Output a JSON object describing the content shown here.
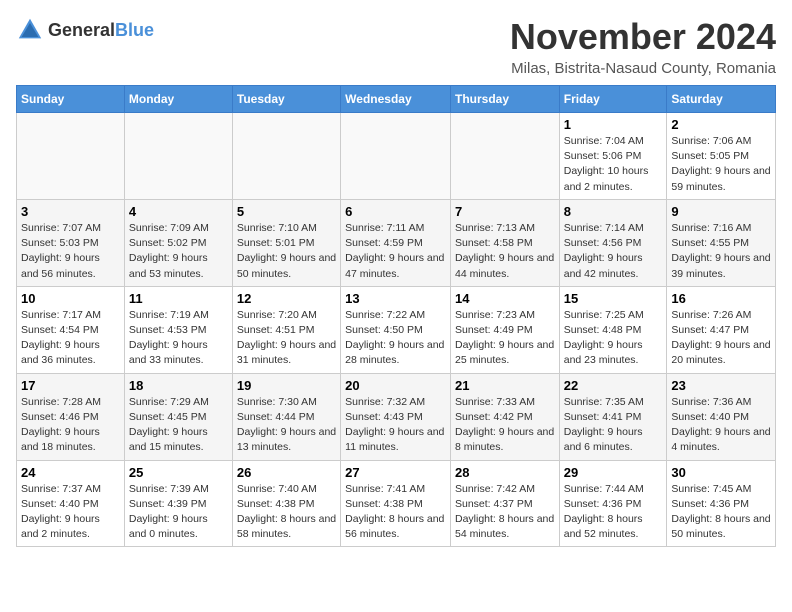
{
  "logo": {
    "general": "General",
    "blue": "Blue"
  },
  "header": {
    "month": "November 2024",
    "location": "Milas, Bistrita-Nasaud County, Romania"
  },
  "days_of_week": [
    "Sunday",
    "Monday",
    "Tuesday",
    "Wednesday",
    "Thursday",
    "Friday",
    "Saturday"
  ],
  "weeks": [
    [
      {
        "day": "",
        "info": ""
      },
      {
        "day": "",
        "info": ""
      },
      {
        "day": "",
        "info": ""
      },
      {
        "day": "",
        "info": ""
      },
      {
        "day": "",
        "info": ""
      },
      {
        "day": "1",
        "info": "Sunrise: 7:04 AM\nSunset: 5:06 PM\nDaylight: 10 hours and 2 minutes."
      },
      {
        "day": "2",
        "info": "Sunrise: 7:06 AM\nSunset: 5:05 PM\nDaylight: 9 hours and 59 minutes."
      }
    ],
    [
      {
        "day": "3",
        "info": "Sunrise: 7:07 AM\nSunset: 5:03 PM\nDaylight: 9 hours and 56 minutes."
      },
      {
        "day": "4",
        "info": "Sunrise: 7:09 AM\nSunset: 5:02 PM\nDaylight: 9 hours and 53 minutes."
      },
      {
        "day": "5",
        "info": "Sunrise: 7:10 AM\nSunset: 5:01 PM\nDaylight: 9 hours and 50 minutes."
      },
      {
        "day": "6",
        "info": "Sunrise: 7:11 AM\nSunset: 4:59 PM\nDaylight: 9 hours and 47 minutes."
      },
      {
        "day": "7",
        "info": "Sunrise: 7:13 AM\nSunset: 4:58 PM\nDaylight: 9 hours and 44 minutes."
      },
      {
        "day": "8",
        "info": "Sunrise: 7:14 AM\nSunset: 4:56 PM\nDaylight: 9 hours and 42 minutes."
      },
      {
        "day": "9",
        "info": "Sunrise: 7:16 AM\nSunset: 4:55 PM\nDaylight: 9 hours and 39 minutes."
      }
    ],
    [
      {
        "day": "10",
        "info": "Sunrise: 7:17 AM\nSunset: 4:54 PM\nDaylight: 9 hours and 36 minutes."
      },
      {
        "day": "11",
        "info": "Sunrise: 7:19 AM\nSunset: 4:53 PM\nDaylight: 9 hours and 33 minutes."
      },
      {
        "day": "12",
        "info": "Sunrise: 7:20 AM\nSunset: 4:51 PM\nDaylight: 9 hours and 31 minutes."
      },
      {
        "day": "13",
        "info": "Sunrise: 7:22 AM\nSunset: 4:50 PM\nDaylight: 9 hours and 28 minutes."
      },
      {
        "day": "14",
        "info": "Sunrise: 7:23 AM\nSunset: 4:49 PM\nDaylight: 9 hours and 25 minutes."
      },
      {
        "day": "15",
        "info": "Sunrise: 7:25 AM\nSunset: 4:48 PM\nDaylight: 9 hours and 23 minutes."
      },
      {
        "day": "16",
        "info": "Sunrise: 7:26 AM\nSunset: 4:47 PM\nDaylight: 9 hours and 20 minutes."
      }
    ],
    [
      {
        "day": "17",
        "info": "Sunrise: 7:28 AM\nSunset: 4:46 PM\nDaylight: 9 hours and 18 minutes."
      },
      {
        "day": "18",
        "info": "Sunrise: 7:29 AM\nSunset: 4:45 PM\nDaylight: 9 hours and 15 minutes."
      },
      {
        "day": "19",
        "info": "Sunrise: 7:30 AM\nSunset: 4:44 PM\nDaylight: 9 hours and 13 minutes."
      },
      {
        "day": "20",
        "info": "Sunrise: 7:32 AM\nSunset: 4:43 PM\nDaylight: 9 hours and 11 minutes."
      },
      {
        "day": "21",
        "info": "Sunrise: 7:33 AM\nSunset: 4:42 PM\nDaylight: 9 hours and 8 minutes."
      },
      {
        "day": "22",
        "info": "Sunrise: 7:35 AM\nSunset: 4:41 PM\nDaylight: 9 hours and 6 minutes."
      },
      {
        "day": "23",
        "info": "Sunrise: 7:36 AM\nSunset: 4:40 PM\nDaylight: 9 hours and 4 minutes."
      }
    ],
    [
      {
        "day": "24",
        "info": "Sunrise: 7:37 AM\nSunset: 4:40 PM\nDaylight: 9 hours and 2 minutes."
      },
      {
        "day": "25",
        "info": "Sunrise: 7:39 AM\nSunset: 4:39 PM\nDaylight: 9 hours and 0 minutes."
      },
      {
        "day": "26",
        "info": "Sunrise: 7:40 AM\nSunset: 4:38 PM\nDaylight: 8 hours and 58 minutes."
      },
      {
        "day": "27",
        "info": "Sunrise: 7:41 AM\nSunset: 4:38 PM\nDaylight: 8 hours and 56 minutes."
      },
      {
        "day": "28",
        "info": "Sunrise: 7:42 AM\nSunset: 4:37 PM\nDaylight: 8 hours and 54 minutes."
      },
      {
        "day": "29",
        "info": "Sunrise: 7:44 AM\nSunset: 4:36 PM\nDaylight: 8 hours and 52 minutes."
      },
      {
        "day": "30",
        "info": "Sunrise: 7:45 AM\nSunset: 4:36 PM\nDaylight: 8 hours and 50 minutes."
      }
    ]
  ]
}
